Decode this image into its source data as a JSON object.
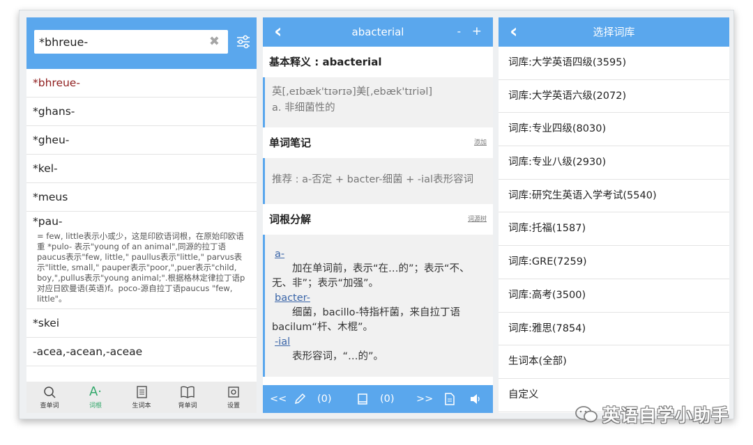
{
  "word_list_panel": {
    "search": {
      "value": "*bhreue-",
      "clear_icon": "close-icon",
      "filter_icon": "filter-sliders-icon"
    },
    "words": [
      {
        "word": "*bhreue-"
      },
      {
        "word": "*ghans-"
      },
      {
        "word": "*gheu-"
      },
      {
        "word": "*kel-"
      },
      {
        "word": "*meus"
      },
      {
        "word": "*pau-",
        "desc": "= few, little表示小或少，这是印欧语词根，在原始印欧语重 *pulo- 表示\"young of an animal\",同源的拉丁语paucus表示\"few, little,\" paullus表示\"little,\" parvus表示\"little, small,\" pauper表示\"poor,\",puer表示\"child, boy,\",pullus表示\"young animal;\".根据格林定律拉丁语p对应日欧曼语(英语)f。poco-源自拉丁语paucus \"few, little\"。"
      },
      {
        "word": "*skei"
      },
      {
        "word": "-acea,-acean,-aceae"
      }
    ],
    "tabs": [
      {
        "label": "查单词",
        "icon": "search-icon"
      },
      {
        "label": "词根",
        "icon": "root-icon"
      },
      {
        "label": "生词本",
        "icon": "notebook-icon"
      },
      {
        "label": "背单词",
        "icon": "book-icon"
      },
      {
        "label": "设置",
        "icon": "settings-icon"
      }
    ]
  },
  "detail_panel": {
    "title": "abacterial",
    "zoom_minus": "-",
    "zoom_plus": "+",
    "basic_heading": "基本释义 : abacterial",
    "phonetic": "英[,eɪbæk'tɪərɪə]美[,ebæk'tɪriəl]",
    "meaning": "a. 非细菌性的",
    "notes_heading": "单词笔记",
    "notes_add": "添加",
    "recommend": "推荐 : a-否定 + bacter-细菌 + -ial表形容词",
    "roots_heading": "词根分解",
    "roots_tree": "词源树",
    "roots": [
      {
        "root": "a-",
        "desc": "加在单词前，表示“在…的”；表示“不、无、非”；表示“加强”。"
      },
      {
        "root": "bacter-",
        "desc": "细菌，bacillo-特指杆菌，来自拉丁语bacilum“杆、木棍”。"
      },
      {
        "root": "-ial",
        "desc": "表形容词，“…的”。"
      }
    ],
    "bottombar": {
      "prev": "<<",
      "pencil_count": "(0)",
      "note_count": "(0)",
      "next": ">>"
    }
  },
  "library_panel": {
    "title": "选择词库",
    "items": [
      "词库:大学英语四级(3595)",
      "词库:大学英语六级(2072)",
      "词库:专业四级(8030)",
      "词库:专业八级(2930)",
      "词库:研究生英语入学考试(5540)",
      "词库:托福(1587)",
      "词库:GRE(7259)",
      "词库:高考(3500)",
      "词库:雅思(7854)",
      "生词本(全部)",
      "自定义"
    ]
  },
  "watermark": {
    "text": "英语自学小助手"
  },
  "colors": {
    "accent_blue": "#5aa7ed",
    "active_word": "#8e1c1c",
    "active_tab": "#33a86b"
  }
}
